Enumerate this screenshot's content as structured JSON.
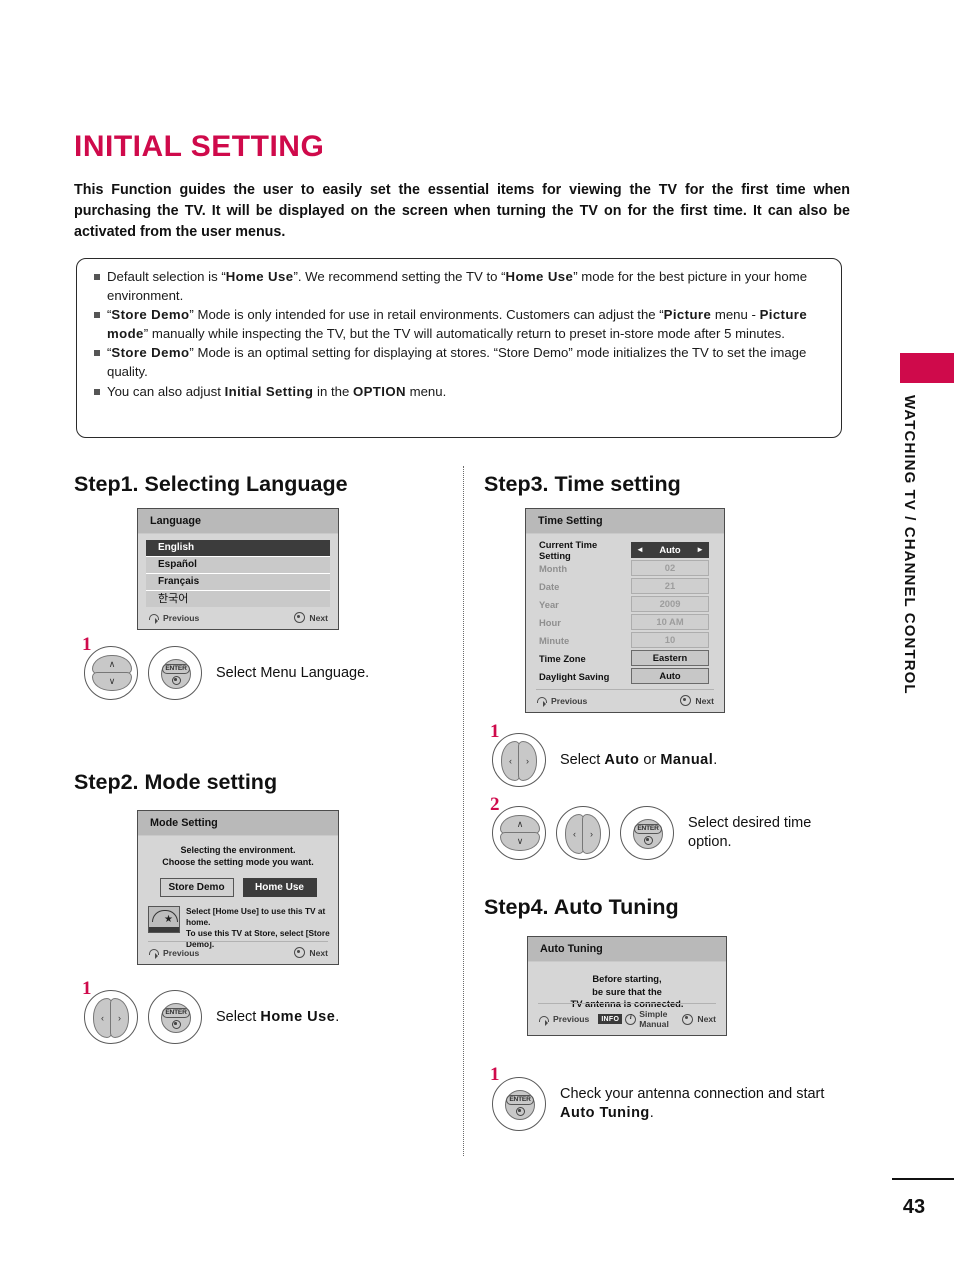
{
  "page": {
    "title": "INITIAL SETTING",
    "intro": "This Function guides the user to easily set the essential items for viewing the TV for the first time when purchasing the TV. It will be displayed on the screen when turning the TV on for the first time. It can also be activated from the user menus.",
    "number": "43",
    "side_tab": "WATCHING TV / CHANNEL CONTROL",
    "accent_color": "#CF0A4B"
  },
  "notes": [
    {
      "parts": [
        {
          "t": "Default selection is “",
          "b": false
        },
        {
          "t": "Home Use",
          "b": true
        },
        {
          "t": "”. We recommend setting the TV to “",
          "b": false
        },
        {
          "t": "Home Use",
          "b": true
        },
        {
          "t": "” mode for the best picture in your home environment.",
          "b": false
        }
      ]
    },
    {
      "parts": [
        {
          "t": "“",
          "b": false
        },
        {
          "t": "Store Demo",
          "b": true
        },
        {
          "t": "” Mode is only intended for use in retail environments. Customers can adjust the “",
          "b": false
        },
        {
          "t": "Picture",
          "b": true
        },
        {
          "t": " menu - ",
          "b": false
        },
        {
          "t": "Picture mode",
          "b": true
        },
        {
          "t": "” manually while inspecting the TV, but the TV will automatically return to preset in-store mode after 5 minutes.",
          "b": false
        }
      ]
    },
    {
      "parts": [
        {
          "t": "“",
          "b": false
        },
        {
          "t": "Store Demo",
          "b": true
        },
        {
          "t": "” Mode is an optimal setting for displaying at stores. “Store Demo” mode initializes the TV to set the image quality.",
          "b": false
        }
      ]
    },
    {
      "parts": [
        {
          "t": "You can also adjust ",
          "b": false
        },
        {
          "t": "Initial Setting",
          "b": true
        },
        {
          "t": " in the ",
          "b": false
        },
        {
          "t": "OPTION",
          "b": true
        },
        {
          "t": " menu.",
          "b": false
        }
      ]
    }
  ],
  "steps": {
    "step1": {
      "heading": "Step1. Selecting Language",
      "osd": {
        "title": "Language",
        "options": [
          {
            "label": "English",
            "selected": true
          },
          {
            "label": "Español",
            "selected": false
          },
          {
            "label": "Français",
            "selected": false
          },
          {
            "label": "한국어",
            "selected": false
          }
        ],
        "footer": {
          "previous": "Previous",
          "next": "Next"
        }
      },
      "key_step": "1",
      "caption_parts": [
        {
          "t": "Select Menu Language.",
          "b": false
        }
      ]
    },
    "step2": {
      "heading": "Step2. Mode setting",
      "osd": {
        "title": "Mode Setting",
        "desc_line1": "Selecting the environment.",
        "desc_line2": "Choose the setting mode you want.",
        "buttons": [
          {
            "label": "Store Demo",
            "selected": false
          },
          {
            "label": "Home Use",
            "selected": true
          }
        ],
        "note_line1": "Select [Home Use] to use this TV at home.",
        "note_line2": "To use this TV at Store, select [Store Demo].",
        "logo": "energy-star-logo",
        "footer": {
          "previous": "Previous",
          "next": "Next"
        }
      },
      "key_step": "1",
      "caption_parts": [
        {
          "t": "Select ",
          "b": false
        },
        {
          "t": "Home Use",
          "b": true
        },
        {
          "t": ".",
          "b": false
        }
      ]
    },
    "step3": {
      "heading": "Step3. Time setting",
      "osd": {
        "title": "Time Setting",
        "rows": [
          {
            "label": "Current Time Setting",
            "value": "Auto",
            "selected": true,
            "dim": false,
            "arrows": true
          },
          {
            "label": "Month",
            "value": "02",
            "selected": false,
            "dim": true,
            "arrows": false
          },
          {
            "label": "Date",
            "value": "21",
            "selected": false,
            "dim": true,
            "arrows": false
          },
          {
            "label": "Year",
            "value": "2009",
            "selected": false,
            "dim": true,
            "arrows": false
          },
          {
            "label": "Hour",
            "value": "10 AM",
            "selected": false,
            "dim": true,
            "arrows": false
          },
          {
            "label": "Minute",
            "value": "10",
            "selected": false,
            "dim": true,
            "arrows": false
          },
          {
            "label": "Time Zone",
            "value": "Eastern",
            "selected": false,
            "dim": false,
            "arrows": false
          },
          {
            "label": "Daylight Saving",
            "value": "Auto",
            "selected": false,
            "dim": false,
            "arrows": false
          }
        ],
        "footer": {
          "previous": "Previous",
          "next": "Next"
        }
      },
      "key_step_a": "1",
      "caption_a_parts": [
        {
          "t": "Select ",
          "b": false
        },
        {
          "t": "Auto",
          "b": true
        },
        {
          "t": " or ",
          "b": false
        },
        {
          "t": "Manual",
          "b": true
        },
        {
          "t": ".",
          "b": false
        }
      ],
      "key_step_b": "2",
      "caption_b_line1": "Select desired time",
      "caption_b_line2": "option."
    },
    "step4": {
      "heading": "Step4. Auto Tuning",
      "osd": {
        "title": "Auto Tuning",
        "msg_line1": "Before starting,",
        "msg_line2": "be sure that the",
        "msg_line3": "TV antenna is connected.",
        "footer": {
          "previous": "Previous",
          "info_badge": "INFO",
          "simple_manual": "Simple Manual",
          "next": "Next"
        }
      },
      "key_step": "1",
      "caption_line1": "Check your antenna connection and start",
      "caption_line2_parts": [
        {
          "t": "Auto Tuning",
          "b": true
        },
        {
          "t": ".",
          "b": false
        }
      ]
    }
  },
  "key_labels": {
    "enter": "ENTER",
    "up": "∧",
    "down": "∨",
    "left": "‹",
    "right": "›"
  }
}
